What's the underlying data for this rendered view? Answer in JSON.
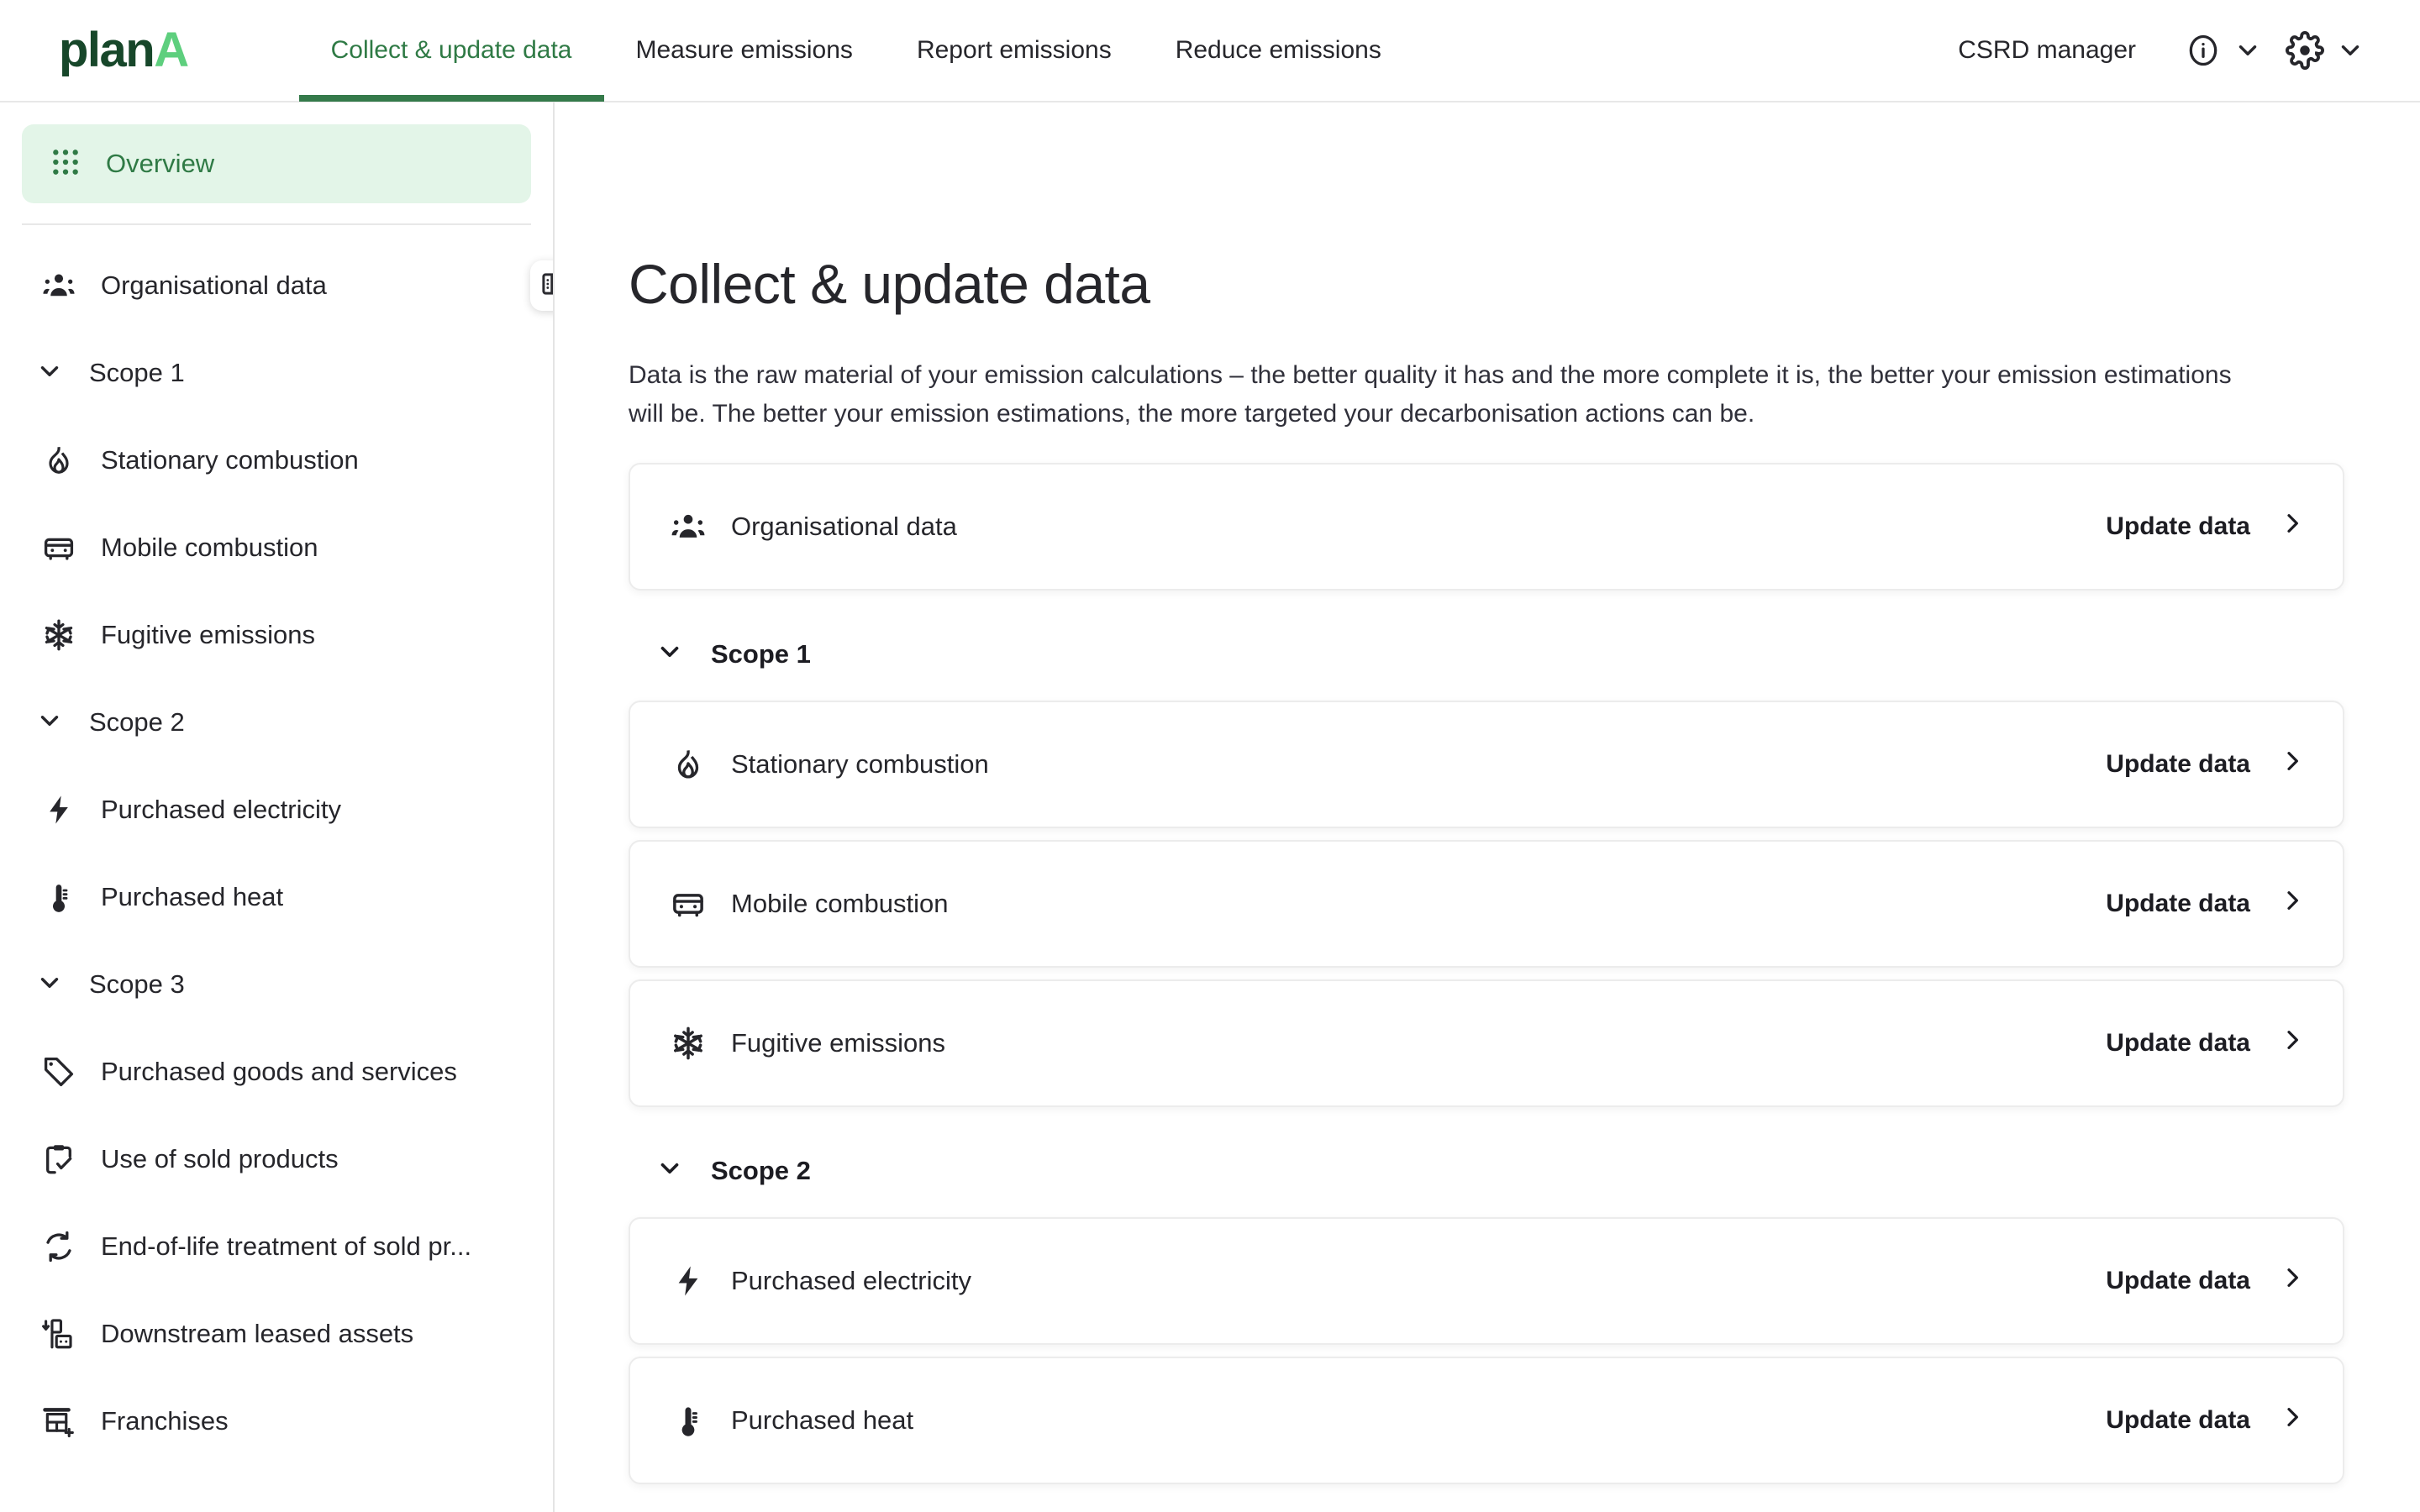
{
  "brand": {
    "name_part1": "plan",
    "name_part2": "A"
  },
  "header": {
    "tabs": [
      {
        "label": "Collect & update data",
        "active": true
      },
      {
        "label": "Measure emissions",
        "active": false
      },
      {
        "label": "Report emissions",
        "active": false
      },
      {
        "label": "Reduce emissions",
        "active": false
      }
    ],
    "user_role": "CSRD manager",
    "info_icon": "info-circle-icon",
    "settings_icon": "gear-icon",
    "chevron_icon": "chevron-down-icon"
  },
  "sidebar": {
    "overview": {
      "label": "Overview",
      "icon": "grid-dots-icon",
      "active": true
    },
    "organisational": {
      "label": "Organisational data",
      "icon": "people-icon"
    },
    "groups": [
      {
        "label": "Scope 1",
        "expanded": true,
        "items": [
          {
            "label": "Stationary combustion",
            "icon": "flame-icon"
          },
          {
            "label": "Mobile combustion",
            "icon": "car-icon"
          },
          {
            "label": "Fugitive emissions",
            "icon": "snowflake-icon"
          }
        ]
      },
      {
        "label": "Scope 2",
        "expanded": true,
        "items": [
          {
            "label": "Purchased electricity",
            "icon": "bolt-icon"
          },
          {
            "label": "Purchased heat",
            "icon": "thermometer-icon"
          }
        ]
      },
      {
        "label": "Scope 3",
        "expanded": true,
        "items": [
          {
            "label": "Purchased goods and services",
            "icon": "tag-icon"
          },
          {
            "label": "Use of sold products",
            "icon": "clipboard-check-icon"
          },
          {
            "label": "End-of-life treatment of sold pr...",
            "icon": "recycle-icon"
          },
          {
            "label": "Downstream leased assets",
            "icon": "downstream-assets-icon"
          },
          {
            "label": "Franchises",
            "icon": "storefront-plus-icon"
          }
        ]
      }
    ],
    "toggle_icon": "sidebar-panel-icon"
  },
  "main": {
    "title": "Collect & update data",
    "description": "Data is the raw material of your emission calculations – the better quality it has and the more complete it is, the better your emission estimations will be. The better your emission estimations, the more targeted your decarbonisation actions can be.",
    "update_label": "Update data",
    "chevron_icon": "chevron-right-icon",
    "org_card": {
      "label": "Organisational data",
      "icon": "people-icon"
    },
    "sections": [
      {
        "label": "Scope 1",
        "expanded": true,
        "cards": [
          {
            "label": "Stationary combustion",
            "icon": "flame-icon"
          },
          {
            "label": "Mobile combustion",
            "icon": "car-icon"
          },
          {
            "label": "Fugitive emissions",
            "icon": "snowflake-icon"
          }
        ]
      },
      {
        "label": "Scope 2",
        "expanded": true,
        "cards": [
          {
            "label": "Purchased electricity",
            "icon": "bolt-icon"
          },
          {
            "label": "Purchased heat",
            "icon": "thermometer-icon"
          }
        ]
      }
    ]
  },
  "colors": {
    "brand_dark_green": "#17472a",
    "brand_light_green": "#5ecf7e",
    "accent_green": "#2f7a45",
    "active_bg": "#e3f5e8",
    "text": "#26262b"
  }
}
